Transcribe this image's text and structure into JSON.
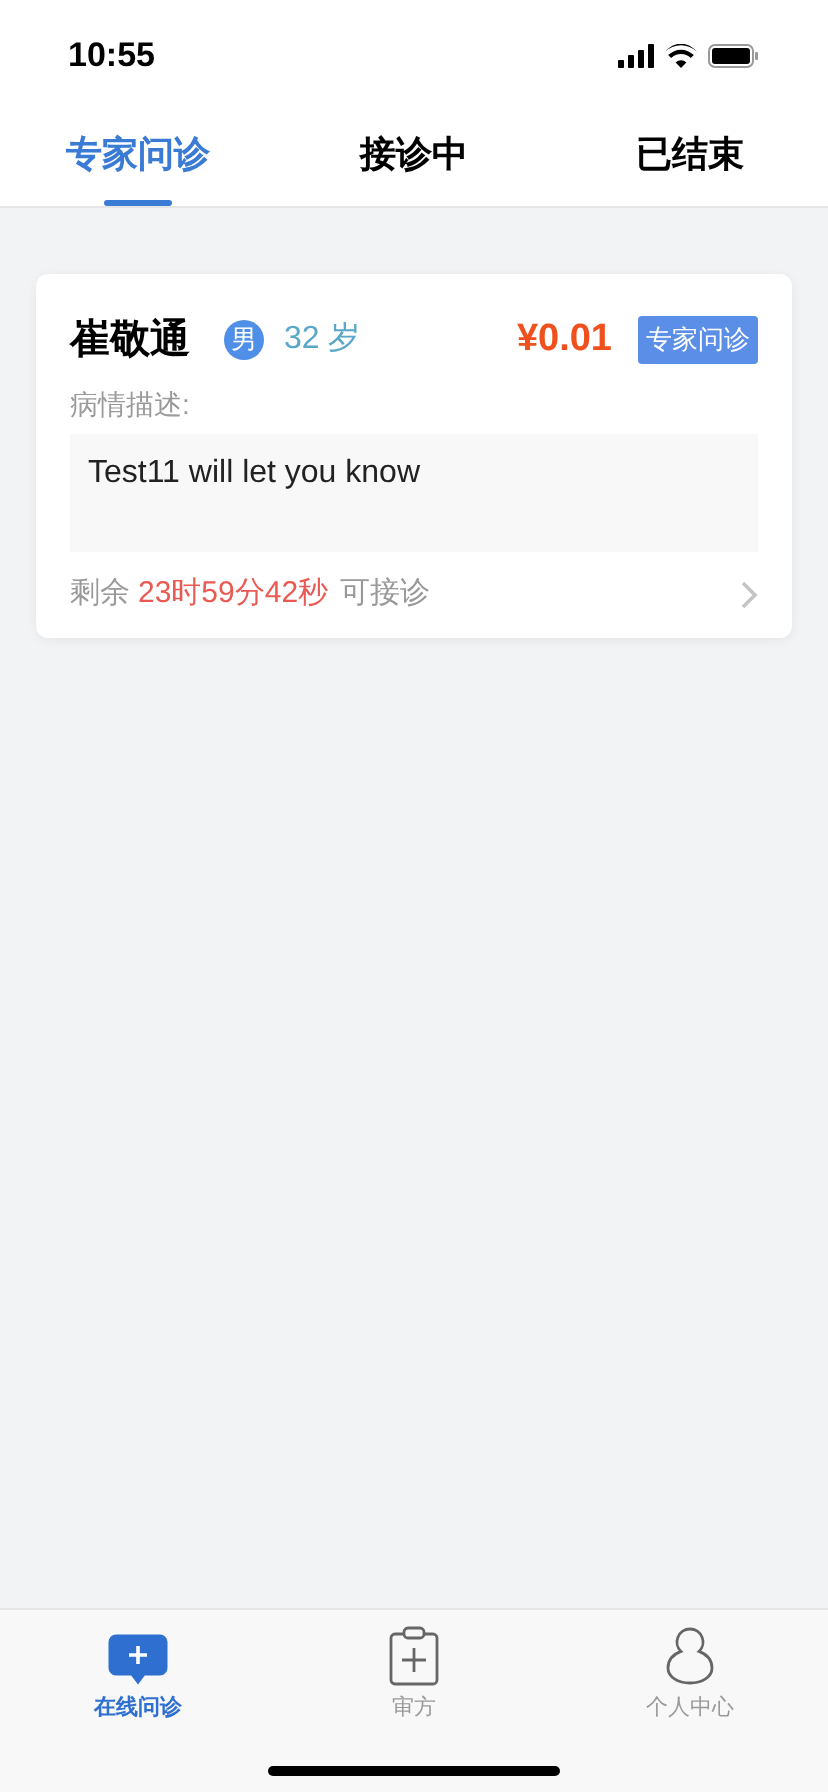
{
  "status_bar": {
    "time": "10:55"
  },
  "tabs": [
    {
      "label": "专家问诊",
      "selected": true
    },
    {
      "label": "接诊中",
      "selected": false
    },
    {
      "label": "已结束",
      "selected": false
    }
  ],
  "consultations": [
    {
      "name": "崔敬通",
      "gender": "男",
      "age": "32 岁",
      "price": "¥0.01",
      "tag": "专家问诊",
      "description_label": "病情描述:",
      "description": "Test11 will let you know",
      "remaining_label": "剩余",
      "remaining_time": "23时59分42秒",
      "status": "可接诊"
    }
  ],
  "bottom_nav": [
    {
      "kind": "consult",
      "label": "在线问诊",
      "selected": true
    },
    {
      "kind": "prescription",
      "label": "审方",
      "selected": false
    },
    {
      "kind": "profile",
      "label": "个人中心",
      "selected": false
    }
  ]
}
